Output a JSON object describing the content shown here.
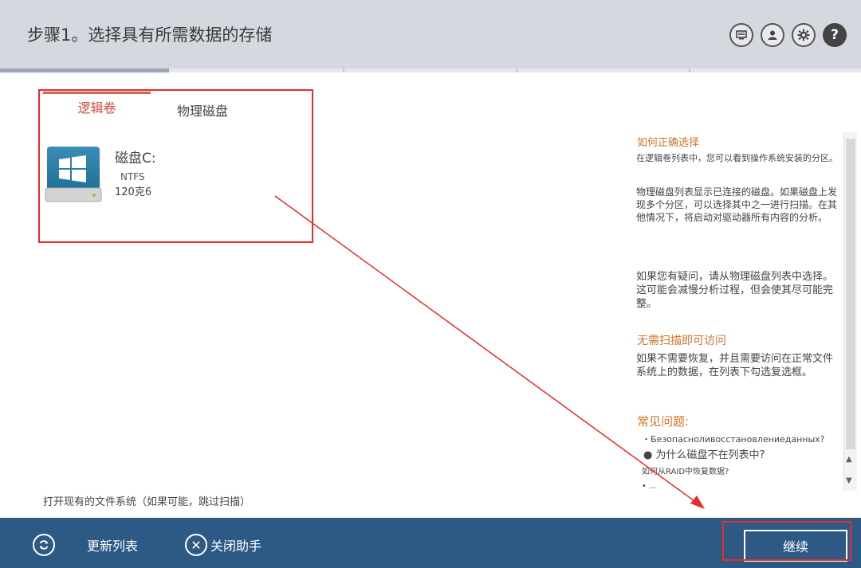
{
  "header": {
    "title": "步骤1。选择具有所需数据的存储",
    "icons": [
      "monitor-icon",
      "user-icon",
      "gear-icon",
      "help-icon"
    ],
    "help_glyph": "?"
  },
  "progress_fraction": 0.2,
  "tabs": [
    {
      "label": "逻辑卷",
      "active": true
    },
    {
      "label": "物理磁盘",
      "active": false
    }
  ],
  "disk": {
    "name": "磁盘C:",
    "fs": "NTFS",
    "size": "120克6"
  },
  "sidebar": {
    "h1": "如何正确选择",
    "p1": "在逻辑卷列表中，您可以看到操作系统安装的分区。",
    "p2": "物理磁盘列表显示已连接的磁盘。如果磁盘上发现多个分区，可以选择其中之一进行扫描。在其他情况下，将启动对驱动器所有内容的分析。",
    "p3": "如果您有疑问，请从物理磁盘列表中选择。这可能会减慢分析过程，但会使其尽可能完整。",
    "h2": "无需扫描即可访问",
    "p4": "如果不需要恢复，并且需要访问在正常文件系统上的数据，在列表下勾选复选框。",
    "h3": "常见问题:",
    "faq1": "・Безопасноливосстановлениеданных?",
    "faq2": "● 为什么磁盘不在列表中?",
    "faq3": "如何从RAID中恢复数据?",
    "faq4": "• ..."
  },
  "bottom": {
    "checkbox_label": "打开现有的文件系统（如果可能，跳过扫描）"
  },
  "footer": {
    "refresh_label": "更新列表",
    "close_label": "关闭助手",
    "continue_label": "继续"
  },
  "colors": {
    "accent": "#d24c3c",
    "footer_bg": "#2d5a85",
    "annotation_red": "#e82b2b",
    "sidebar_heading": "#d0742c"
  }
}
